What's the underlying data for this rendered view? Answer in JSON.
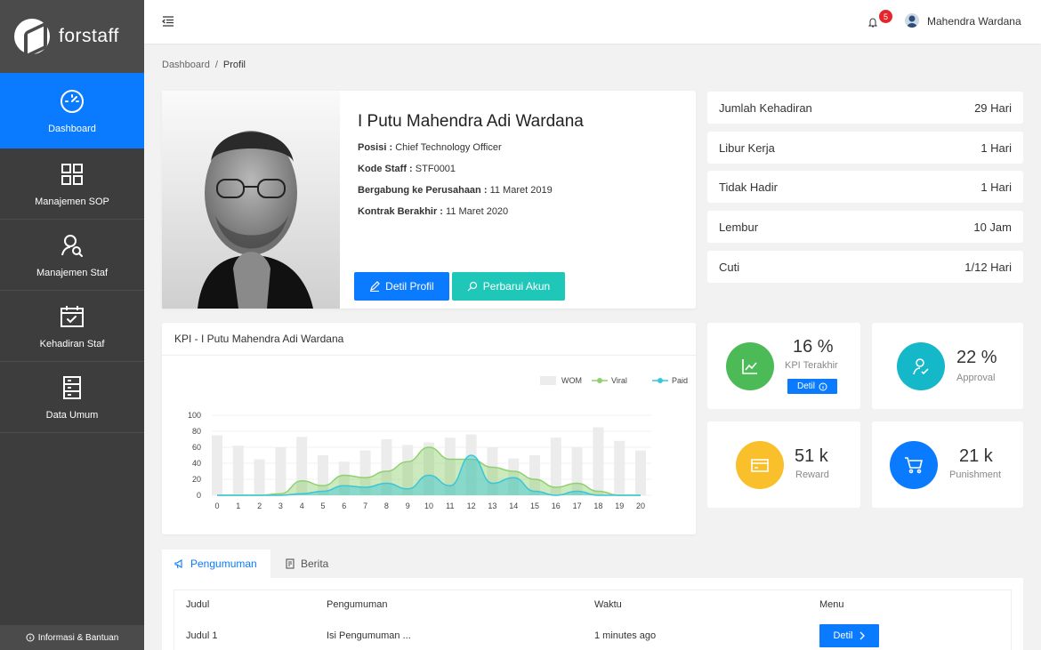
{
  "brand": {
    "name": "forstaff"
  },
  "sidebar": {
    "items": [
      {
        "label": "Dashboard",
        "icon": "speedometer-icon",
        "active": true
      },
      {
        "label": "Manajemen SOP",
        "icon": "grid-icon",
        "active": false
      },
      {
        "label": "Manajemen Staf",
        "icon": "user-search-icon",
        "active": false
      },
      {
        "label": "Kehadiran Staf",
        "icon": "calendar-check-icon",
        "active": false
      },
      {
        "label": "Data Umum",
        "icon": "server-icon",
        "active": false
      }
    ],
    "help": "Informasi & Bantuan"
  },
  "topbar": {
    "notification_count": "5",
    "user_name": "Mahendra Wardana"
  },
  "breadcrumb": {
    "root": "Dashboard",
    "separator": "/",
    "current": "Profil"
  },
  "profile": {
    "name": "I Putu Mahendra Adi Wardana",
    "position_label": "Posisi :",
    "position": "Chief Technology Officer",
    "staff_code_label": "Kode Staff :",
    "staff_code": "STF0001",
    "joined_label": "Bergabung ke Perusahaan :",
    "joined": "11 Maret 2019",
    "contract_end_label": "Kontrak Berakhir :",
    "contract_end": "11 Maret 2020",
    "btn_detail": "Detil Profil",
    "btn_update": "Perbarui Akun"
  },
  "stats": [
    {
      "label": "Jumlah Kehadiran",
      "value": "29 Hari"
    },
    {
      "label": "Libur Kerja",
      "value": "1 Hari"
    },
    {
      "label": "Tidak Hadir",
      "value": "1 Hari"
    },
    {
      "label": "Lembur",
      "value": "10 Jam"
    },
    {
      "label": "Cuti",
      "value": "1/12 Hari"
    }
  ],
  "kpi_card": {
    "title": "KPI - I Putu Mahendra Adi Wardana"
  },
  "chart_data": {
    "type": "bar",
    "x": [
      0,
      1,
      2,
      3,
      4,
      5,
      6,
      7,
      8,
      9,
      10,
      11,
      12,
      13,
      14,
      15,
      16,
      17,
      18,
      19,
      20
    ],
    "ylim": [
      0,
      100
    ],
    "yticks": [
      0,
      20,
      40,
      60,
      80,
      100
    ],
    "legend_position": "top-right",
    "series": [
      {
        "name": "WOM",
        "kind": "bar",
        "color": "#ececec",
        "values": [
          75,
          62,
          45,
          60,
          73,
          50,
          42,
          56,
          70,
          63,
          66,
          72,
          76,
          60,
          46,
          50,
          72,
          60,
          85,
          68,
          56
        ]
      },
      {
        "name": "Viral",
        "kind": "area",
        "color": "#8fd16e",
        "values": [
          0,
          0,
          0,
          2,
          18,
          12,
          25,
          22,
          30,
          42,
          60,
          45,
          45,
          35,
          30,
          20,
          10,
          15,
          5,
          0,
          0
        ]
      },
      {
        "name": "Paid",
        "kind": "area",
        "color": "#38c6d9",
        "values": [
          0,
          0,
          0,
          0,
          2,
          5,
          12,
          10,
          15,
          8,
          25,
          12,
          50,
          15,
          22,
          5,
          0,
          5,
          0,
          0,
          0
        ]
      }
    ]
  },
  "tiles": [
    {
      "value": "16 %",
      "label": "KPI Terakhir",
      "icon": "trending-chart-icon",
      "color": "#4cbb57",
      "button": "Detil"
    },
    {
      "value": "22 %",
      "label": "Approval",
      "icon": "user-approve-icon",
      "color": "#14b8c8"
    },
    {
      "value": "51 k",
      "label": "Reward",
      "icon": "card-icon",
      "color": "#f9c02c"
    },
    {
      "value": "21 k",
      "label": "Punishment",
      "icon": "cart-icon",
      "color": "#0a7bff"
    }
  ],
  "tabs": [
    {
      "label": "Pengumuman",
      "icon": "megaphone-icon",
      "active": true
    },
    {
      "label": "Berita",
      "icon": "news-icon",
      "active": false
    }
  ],
  "table": {
    "columns": [
      "Judul",
      "Pengumuman",
      "Waktu",
      "Menu"
    ],
    "rows": [
      {
        "judul": "Judul 1",
        "pengumuman": "Isi Pengumuman ...",
        "waktu": "1 minutes ago",
        "menu": "Detil"
      }
    ]
  }
}
